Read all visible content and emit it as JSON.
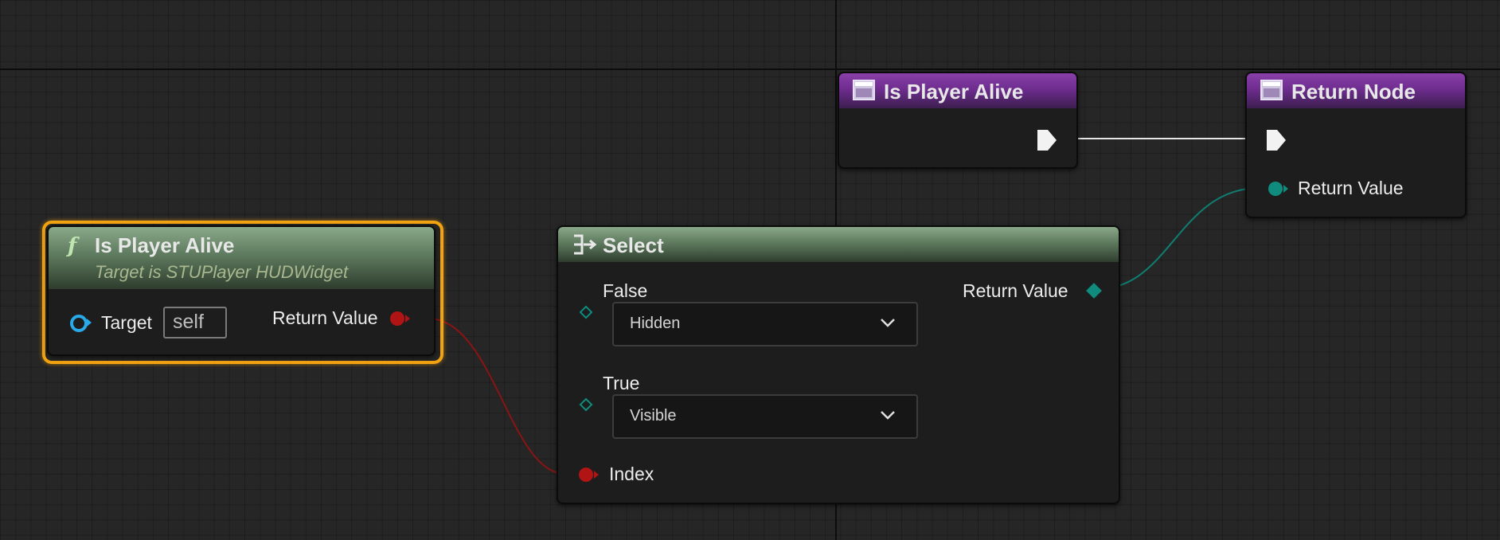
{
  "graph": {
    "nodes": {
      "is_player_alive_entry": {
        "title": "Is Player Alive"
      },
      "return_node": {
        "title": "Return Node",
        "return_pin_label": "Return Value"
      },
      "is_player_alive_call": {
        "title": "Is Player Alive",
        "subtitle": "Target is STUPlayer HUDWidget",
        "target_label": "Target",
        "target_value": "self",
        "return_pin_label": "Return Value",
        "selected": true
      },
      "select": {
        "title": "Select",
        "false_label": "False",
        "false_value": "Hidden",
        "true_label": "True",
        "true_value": "Visible",
        "index_label": "Index",
        "return_pin_label": "Return Value"
      }
    },
    "icons": [
      "struct-icon",
      "function-icon",
      "select-icon",
      "exec-pin-icon",
      "chevron-down-icon"
    ],
    "colors": {
      "background": "#262626",
      "purple_header": "#6e2d8f",
      "green_header": "#5e7a5e",
      "selection": "#f3a311",
      "teal_pin": "#0f8c7e",
      "red_pin": "#b11414",
      "blue_pin": "#2aa9e8",
      "exec_wire": "#e6e6e6"
    }
  }
}
